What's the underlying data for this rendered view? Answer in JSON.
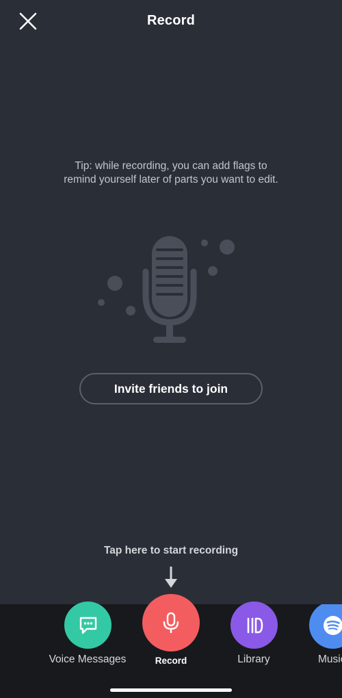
{
  "header": {
    "title": "Record"
  },
  "tip": {
    "text": "Tip: while recording, you can add flags to remind yourself later of parts you want to edit."
  },
  "invite": {
    "label": "Invite friends to join"
  },
  "hint": {
    "text": "Tap here to start recording"
  },
  "nav": {
    "items": [
      {
        "label": "Voice Messages",
        "color": "#33c9a4",
        "icon": "chat-bubble-icon"
      },
      {
        "label": "Record",
        "color": "#f45d60",
        "icon": "microphone-icon",
        "active": true
      },
      {
        "label": "Library",
        "color": "#8a59e8",
        "icon": "library-icon"
      },
      {
        "label": "Music",
        "color": "#4e8cf0",
        "icon": "spotify-icon"
      }
    ]
  },
  "colors": {
    "background": "#2a2e37",
    "dock": "#17191d",
    "illustration": "#4a4e59"
  }
}
